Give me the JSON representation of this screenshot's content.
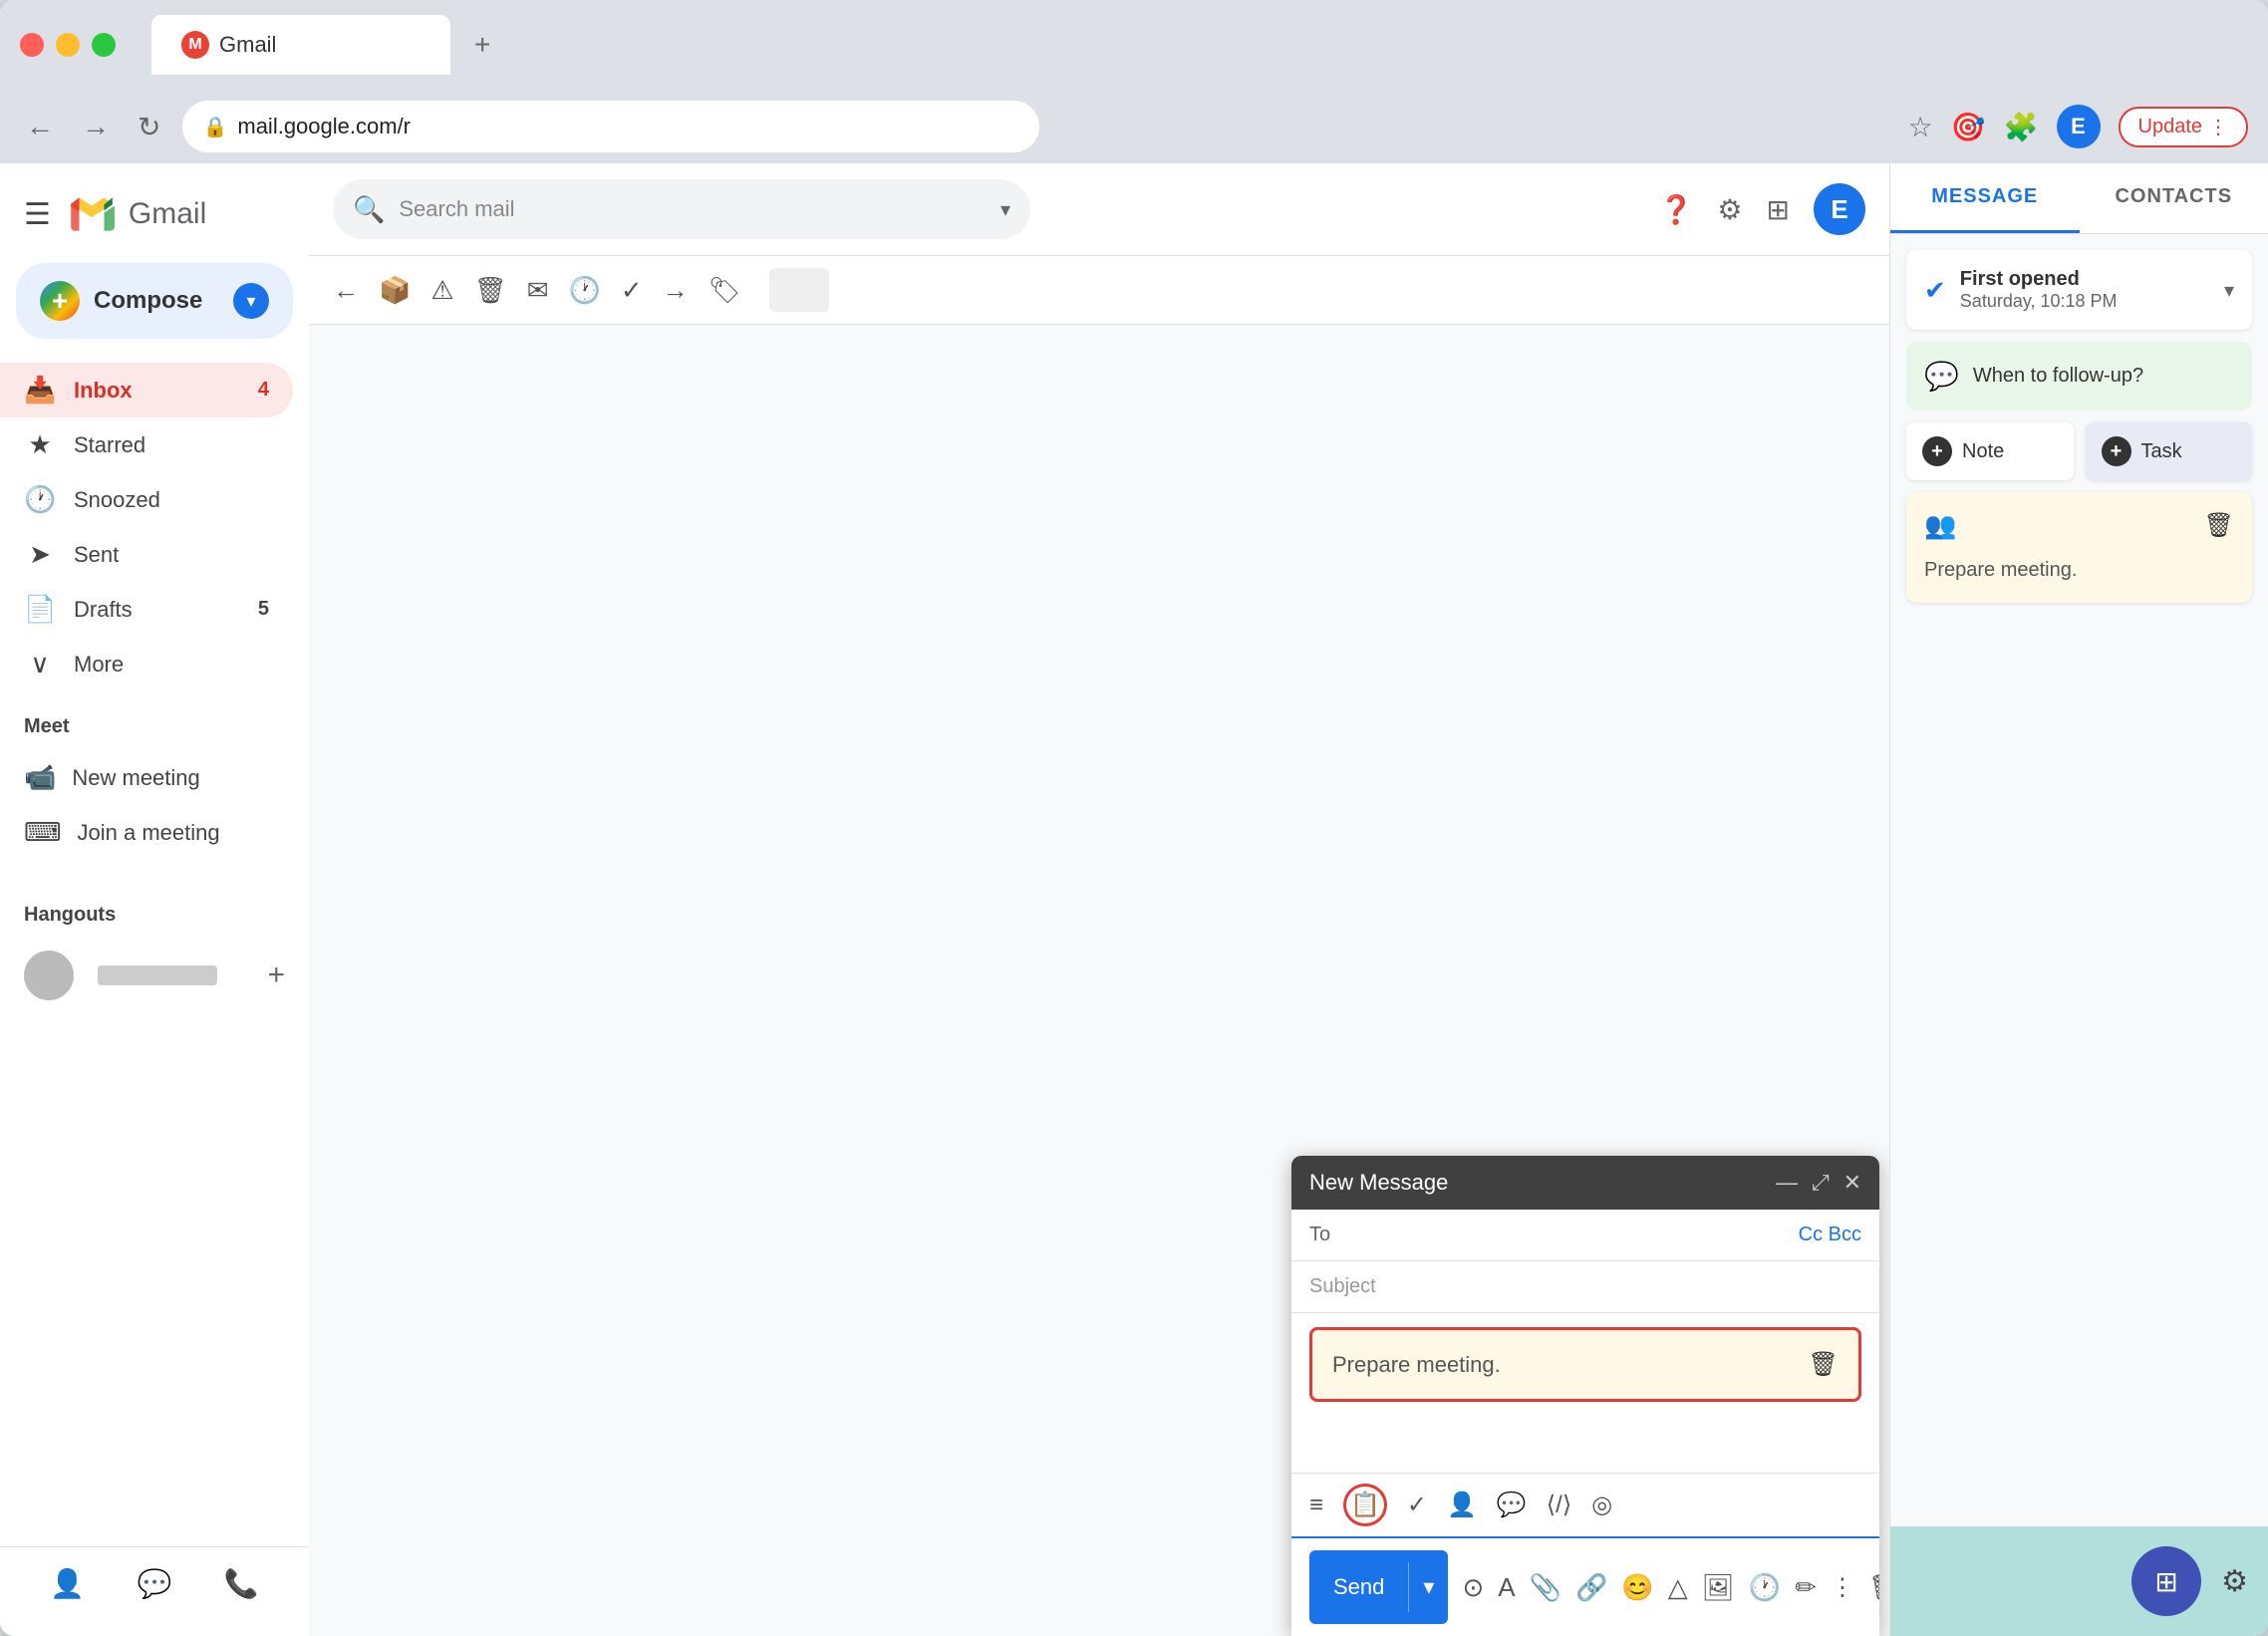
{
  "browser": {
    "tab_title": "Gmail",
    "tab_favicon": "M",
    "new_tab": "+",
    "address": "mail.google.com/r",
    "nav_back": "←",
    "nav_forward": "→",
    "nav_refresh": "↻",
    "star_icon": "☆",
    "update_label": "Update",
    "extension_dots": "⋮"
  },
  "gmail": {
    "logo": "M",
    "app_name": "Gmail",
    "search_placeholder": "Search mail",
    "nav_items": [
      {
        "icon": "☰",
        "label": ""
      },
      {
        "icon": "📥",
        "label": "Inbox",
        "badge": "4",
        "active": true
      },
      {
        "icon": "★",
        "label": "Starred",
        "badge": ""
      },
      {
        "icon": "🕐",
        "label": "Snoozed",
        "badge": ""
      },
      {
        "icon": "➤",
        "label": "Sent",
        "badge": ""
      },
      {
        "icon": "📄",
        "label": "Drafts",
        "badge": "5"
      },
      {
        "icon": "∨",
        "label": "More",
        "badge": ""
      }
    ],
    "compose_label": "Compose",
    "meet_label": "Meet",
    "new_meeting_label": "New meeting",
    "join_meeting_label": "Join a meeting",
    "hangouts_label": "Hangouts"
  },
  "compose": {
    "title": "New Message",
    "to_label": "To",
    "cc_bcc": "Cc Bcc",
    "subject_placeholder": "Subject",
    "minimize_icon": "—",
    "expand_icon": "⤢",
    "close_icon": "✕",
    "note_text": "Prepare meeting.",
    "send_label": "Send",
    "boomerang_icons": [
      "≡≡",
      "📋",
      "✓",
      "👤",
      "💬",
      "⟨⟩",
      "◎"
    ]
  },
  "right_panel": {
    "tab_message": "MESSAGE",
    "tab_contacts": "CONTACTS",
    "first_opened_title": "First opened",
    "first_opened_time": "Saturday, 10:18 PM",
    "followup_label": "When to follow-up?",
    "note_btn": "Note",
    "task_btn": "Task",
    "note_card_text": "Prepare meeting.",
    "apps_icon": "⊞",
    "settings_icon": "⚙"
  },
  "toolbar": {
    "icons": [
      "←",
      "📦",
      "!",
      "🗑",
      "✉",
      "🕐",
      "✓",
      "→",
      "🏷"
    ]
  }
}
